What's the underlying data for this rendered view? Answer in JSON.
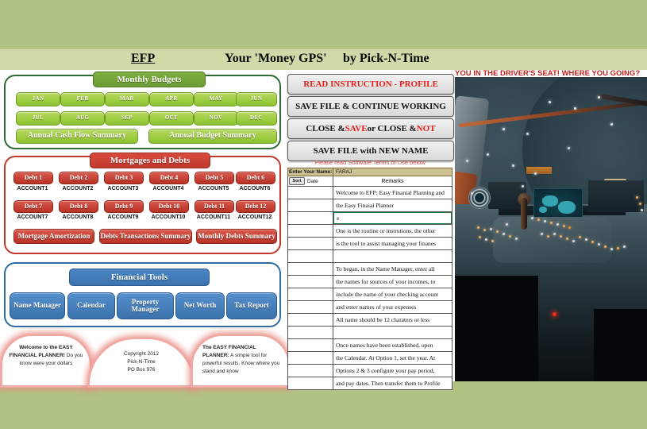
{
  "app": {
    "background_color": "#b0c382",
    "title_band_color": "#cfdaa8"
  },
  "header": {
    "efp": "EFP",
    "money_gps": "Your 'Money GPS'",
    "by_line": "by Pick-N-Time"
  },
  "monthly_budgets": {
    "heading": "Monthly Budgets",
    "months": [
      "JAN",
      "FEB",
      "MAR",
      "APR",
      "MAY",
      "JUN",
      "JUL",
      "AUG",
      "SEP",
      "OCT",
      "NOV",
      "DEC"
    ],
    "summaries": [
      "Annual Cash Flow Summary",
      "Annual Budget Summary"
    ]
  },
  "mortgages_and_debts": {
    "heading": "Mortgages and Debts",
    "debts": [
      {
        "label": "Debt 1",
        "account": "ACCOUNT1"
      },
      {
        "label": "Debt 2",
        "account": "ACCOUNT2"
      },
      {
        "label": "Debt 3",
        "account": "ACCOUNT3"
      },
      {
        "label": "Debt 4",
        "account": "ACCOUNT4"
      },
      {
        "label": "Debt 5",
        "account": "ACCOUNT5"
      },
      {
        "label": "Debt 6",
        "account": "ACCOUNT6"
      },
      {
        "label": "Debt 7",
        "account": "ACCOUNT7"
      },
      {
        "label": "Debt 8",
        "account": "ACCOUNT8"
      },
      {
        "label": "Debt 9",
        "account": "ACCOUNT9"
      },
      {
        "label": "Debt 10",
        "account": "ACCOUNT10"
      },
      {
        "label": "Debt 11",
        "account": "ACCOUNT11"
      },
      {
        "label": "Debt 12",
        "account": "ACCOUNT12"
      }
    ],
    "actions": [
      "Mortgage Amortization",
      "Debts Transactions Summary",
      "Monthly Debts Summary"
    ]
  },
  "financial_tools": {
    "heading": "Financial Tools",
    "tools": [
      "Name Manager",
      "Calendar",
      "Property Manager",
      "Net Worth",
      "Tax Report"
    ]
  },
  "info_blobs": {
    "left_strong": "Welcome to the EASY FINANCIAL PLANNER!",
    "left_rest": " Do you know were your dollars",
    "center_line1": "Copyright 2012",
    "center_line2": "Pick-N-Time",
    "center_line3": "PO Box 976",
    "right_strong": "The EASY FINANCIAL PLANNER:",
    "right_rest": " A simple tool for powerful results. Know where you stand and know"
  },
  "action_buttons": {
    "read_instruction": "READ INSTRUCTION - PROFILE",
    "save_continue": "SAVE FILE & CONTINUE WORKING",
    "close_save_1": "CLOSE & ",
    "close_save_2": "SAVE",
    "close_save_3": " or CLOSE & ",
    "close_save_4": "NOT",
    "save_new_name": "SAVE FILE with NEW NAME",
    "terms_note": "Please read Software Terms of Use below"
  },
  "sheet": {
    "name_label": "Enter Your Name:",
    "name_value": "FARAJ",
    "sort_button": "Sort",
    "date_header": "Date",
    "remarks_header": "Remarks",
    "rows": [
      "Welcome to EFP: Easy Finanial Planning and",
      "the Easy Finaial Planner",
      "s",
      "One is the routine or instrutions, the other",
      "is the tool to assist managing your finanes",
      "",
      "To began, in the Name Manager, enter all",
      "the names for sources of your incomes, to",
      "include the name of your checking account",
      "and enter names of your expenses",
      "All name should be 12 charaters or less",
      "",
      "Once names have  been established, open",
      "the Calendar. At Option 1, set the year. At",
      "Options 2 & 3 configure your pay period,",
      "and pay dates. Then transfer them to Profile"
    ],
    "selected_row_index": 2
  },
  "cockpit": {
    "caption": "YOU IN THE DRIVER'S SEAT! WHERE YOU GOING?"
  }
}
